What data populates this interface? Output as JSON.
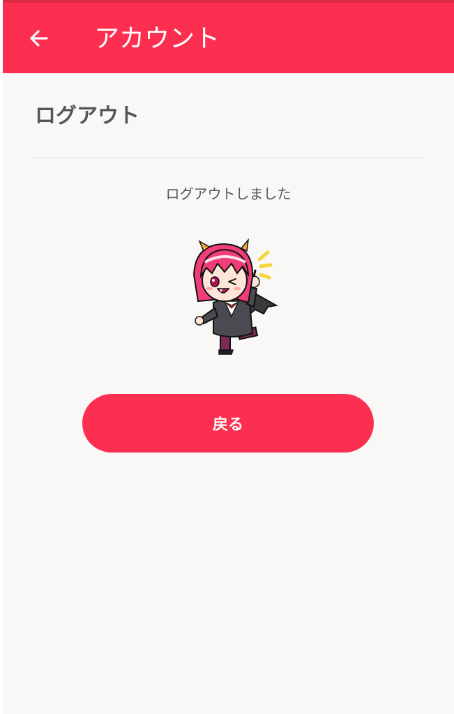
{
  "app_bar": {
    "title": "アカウント",
    "back_icon": "arrow-left-icon"
  },
  "content": {
    "section_title": "ログアウト",
    "message": "ログアウトしました",
    "mascot_image": "devil-girl-mascot-thumbs-up",
    "back_button_label": "戻る"
  },
  "colors": {
    "accent": "#fd2f50",
    "status_strip": "#d92a48",
    "background": "#f9f8f7",
    "text": "#555555"
  }
}
